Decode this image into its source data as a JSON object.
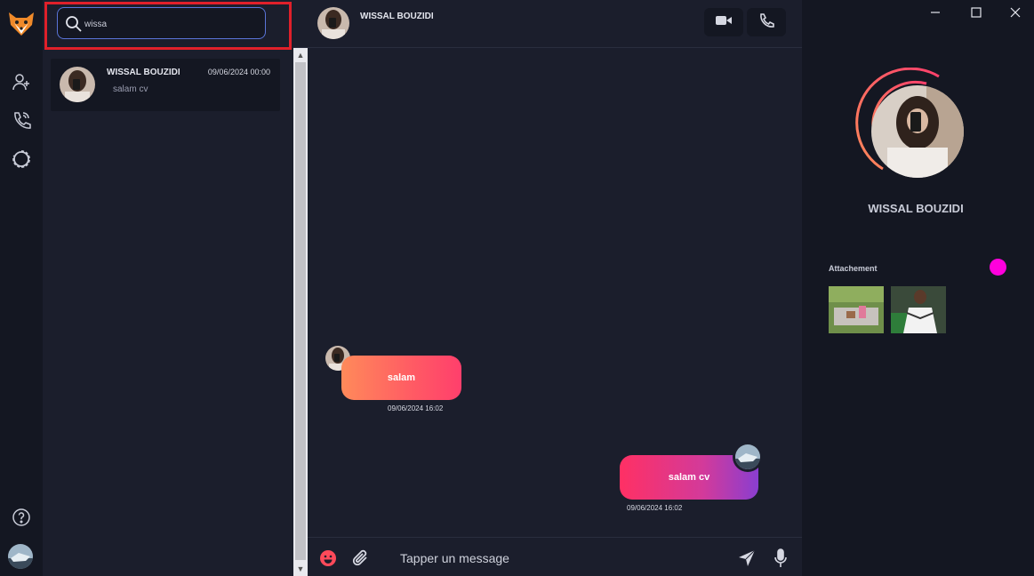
{
  "colors": {
    "accent_pink": "#ff00dd",
    "highlight_red": "#e0202a",
    "bubble_in_start": "#ff8a5a",
    "bubble_out_end": "#8a3ed0"
  },
  "sidebar": {
    "icons": [
      "fox-logo-icon",
      "add-user-icon",
      "phone-call-icon",
      "status-circle-icon",
      "help-icon",
      "user-avatar-icon"
    ]
  },
  "search": {
    "value": "wissa",
    "placeholder": ""
  },
  "conversations": [
    {
      "name": "WISSAL BOUZIDI",
      "date": "09/06/2024 00:00",
      "last_message": "salam cv"
    }
  ],
  "chat": {
    "contact_name": "WISSAL BOUZIDI",
    "messages": [
      {
        "direction": "in",
        "text": "salam",
        "time": "09/06/2024 16:02"
      },
      {
        "direction": "out",
        "text": "salam cv",
        "time": "09/06/2024 16:02"
      }
    ],
    "composer_placeholder": "Tapper un message"
  },
  "profile": {
    "name": "WISSAL BOUZIDI",
    "attachments_label": "Attachement",
    "attachments_count": 2
  }
}
